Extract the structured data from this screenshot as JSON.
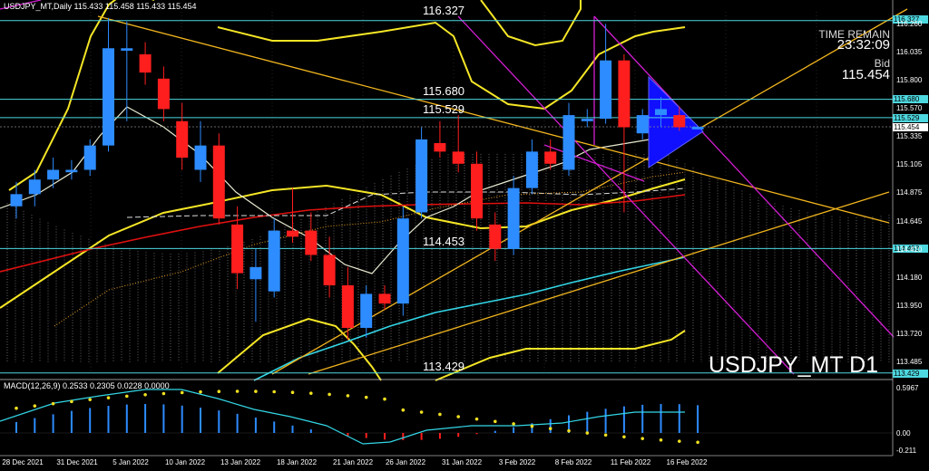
{
  "window": {
    "title": "USDJPY_MT,Daily  115.433 115.458 115.433 115.454",
    "symbol_label": "USDJPY_MT D1"
  },
  "time_remain": {
    "label": "TIME REMAIN",
    "value": "23:32:09"
  },
  "bid": {
    "label": "Bid",
    "value": "115.454"
  },
  "levels": [
    {
      "text": "116.327",
      "price": 116.327,
      "tag": "116.327"
    },
    {
      "text": "115.680",
      "price": 115.68,
      "tag": "115.680"
    },
    {
      "text": "115.529",
      "price": 115.529,
      "tag": "115.529"
    },
    {
      "text": "114.453",
      "price": 114.453,
      "tag": "114.453"
    },
    {
      "text": "113.429",
      "price": 113.429,
      "tag": "113.429"
    }
  ],
  "current_price_tag": "115.454",
  "price_axis": [
    "116.260",
    "116.035",
    "115.800",
    "115.570",
    "115.335",
    "115.105",
    "114.875",
    "114.645",
    "114.410",
    "114.180",
    "113.950",
    "113.720",
    "113.485"
  ],
  "macd": {
    "label": "MACD(12,26,9)  0.2533  0.2305  0.0228  0.0000",
    "axis": [
      "0.5967",
      "0.00",
      "-0.211"
    ]
  },
  "colors": {
    "bull": "#2d8cff",
    "bear": "#ff1e1e",
    "bollinger": "#f5e626",
    "ma_red": "#e01010",
    "ma_cyan": "#33d6e6",
    "ma_white": "#e8e8d0",
    "trendline": "#f0b41e",
    "channel": "#d21ed2",
    "levels": "#4ed8e0",
    "triangle": "#1010ff"
  },
  "chart_data": {
    "type": "candlestick",
    "x_labels": [
      "28 Dec 2021",
      "31 Dec 2021",
      "5 Jan 2022",
      "10 Jan 2022",
      "13 Jan 2022",
      "18 Jan 2022",
      "21 Jan 2022",
      "26 Jan 2022",
      "31 Jan 2022",
      "3 Feb 2022",
      "8 Feb 2022",
      "11 Feb 2022",
      "16 Feb 2022"
    ],
    "ylim": [
      113.42,
      116.4
    ],
    "candles": [
      {
        "o": 114.8,
        "h": 115.0,
        "l": 114.7,
        "c": 114.9
      },
      {
        "o": 114.9,
        "h": 115.1,
        "l": 114.8,
        "c": 115.02
      },
      {
        "o": 115.02,
        "h": 115.2,
        "l": 114.95,
        "c": 115.1
      },
      {
        "o": 115.08,
        "h": 115.18,
        "l": 115.02,
        "c": 115.1
      },
      {
        "o": 115.1,
        "h": 115.35,
        "l": 115.05,
        "c": 115.3
      },
      {
        "o": 115.3,
        "h": 116.35,
        "l": 115.25,
        "c": 116.1
      },
      {
        "o": 116.08,
        "h": 116.32,
        "l": 115.5,
        "c": 116.1
      },
      {
        "o": 116.05,
        "h": 116.15,
        "l": 115.8,
        "c": 115.9
      },
      {
        "o": 115.85,
        "h": 115.95,
        "l": 115.5,
        "c": 115.6
      },
      {
        "o": 115.5,
        "h": 115.65,
        "l": 115.1,
        "c": 115.2
      },
      {
        "o": 115.1,
        "h": 115.5,
        "l": 115.0,
        "c": 115.3
      },
      {
        "o": 115.3,
        "h": 115.4,
        "l": 114.65,
        "c": 114.7
      },
      {
        "o": 114.65,
        "h": 114.8,
        "l": 114.12,
        "c": 114.25
      },
      {
        "o": 114.2,
        "h": 114.45,
        "l": 113.85,
        "c": 114.3
      },
      {
        "o": 114.1,
        "h": 114.7,
        "l": 114.05,
        "c": 114.6
      },
      {
        "o": 114.6,
        "h": 114.95,
        "l": 114.5,
        "c": 114.55
      },
      {
        "o": 114.6,
        "h": 114.75,
        "l": 114.35,
        "c": 114.4
      },
      {
        "o": 114.4,
        "h": 114.55,
        "l": 114.05,
        "c": 114.15
      },
      {
        "o": 114.15,
        "h": 114.3,
        "l": 113.7,
        "c": 113.8
      },
      {
        "o": 113.8,
        "h": 114.15,
        "l": 113.72,
        "c": 114.08
      },
      {
        "o": 114.08,
        "h": 114.15,
        "l": 113.95,
        "c": 114.0
      },
      {
        "o": 114.0,
        "h": 114.8,
        "l": 113.9,
        "c": 114.7
      },
      {
        "o": 114.75,
        "h": 115.45,
        "l": 114.7,
        "c": 115.35
      },
      {
        "o": 115.32,
        "h": 115.5,
        "l": 115.2,
        "c": 115.25
      },
      {
        "o": 115.25,
        "h": 115.55,
        "l": 115.08,
        "c": 115.15
      },
      {
        "o": 115.15,
        "h": 115.25,
        "l": 114.6,
        "c": 114.7
      },
      {
        "o": 114.65,
        "h": 114.75,
        "l": 114.35,
        "c": 114.45
      },
      {
        "o": 114.45,
        "h": 115.05,
        "l": 114.4,
        "c": 114.95
      },
      {
        "o": 114.95,
        "h": 115.35,
        "l": 114.9,
        "c": 115.25
      },
      {
        "o": 115.25,
        "h": 115.35,
        "l": 115.1,
        "c": 115.15
      },
      {
        "o": 115.1,
        "h": 115.65,
        "l": 115.05,
        "c": 115.55
      },
      {
        "o": 115.5,
        "h": 115.6,
        "l": 115.45,
        "c": 115.52
      },
      {
        "o": 115.52,
        "h": 116.3,
        "l": 115.48,
        "c": 116.0
      },
      {
        "o": 116.0,
        "h": 116.05,
        "l": 114.75,
        "c": 115.45
      },
      {
        "o": 115.4,
        "h": 115.6,
        "l": 115.35,
        "c": 115.55
      },
      {
        "o": 115.55,
        "h": 115.7,
        "l": 115.45,
        "c": 115.6
      },
      {
        "o": 115.55,
        "h": 115.62,
        "l": 115.42,
        "c": 115.45
      },
      {
        "o": 115.433,
        "h": 115.458,
        "l": 115.433,
        "c": 115.454
      }
    ]
  }
}
